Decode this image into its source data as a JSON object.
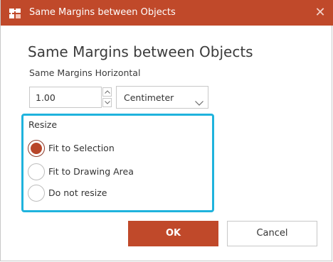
{
  "window": {
    "title": "Same Margins between Objects",
    "close_glyph": "✕",
    "title_bar_color": "#c0492a",
    "app_icon": "puzzle-icon"
  },
  "dialog": {
    "heading": "Same Margins between Objects",
    "horizontal_label": "Same Margins Horizontal",
    "margin_value": "1.00",
    "unit": {
      "selected": "Centimeter"
    },
    "resize": {
      "title": "Resize",
      "highlight_color": "#1fb3dd",
      "options": [
        {
          "label": "Fit to Selection",
          "checked": true
        },
        {
          "label": "Fit to Drawing Area",
          "checked": false
        },
        {
          "label": "Do not resize",
          "checked": false
        }
      ]
    },
    "buttons": {
      "ok": "OK",
      "cancel": "Cancel"
    },
    "accent_color": "#c0492a"
  }
}
